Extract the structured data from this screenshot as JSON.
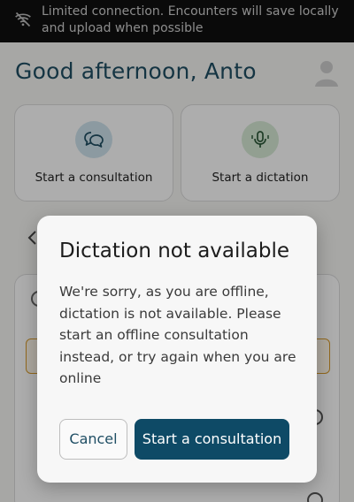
{
  "status_banner": {
    "icon": "wifi-off-icon",
    "text": "Limited connection. Encounters will save locally and upload when possible",
    "background": "#101010"
  },
  "home": {
    "greeting": "Good afternoon, Anto",
    "avatar_icon": "user-avatar-icon",
    "cards": [
      {
        "label": "Start a consultation",
        "icon": "chat-bubbles-icon"
      },
      {
        "label": "Start a dictation",
        "icon": "microphone-icon"
      }
    ]
  },
  "dialog": {
    "title": "Dictation not available",
    "message": "We're sorry, as you are offline, dictation is not available. Please start an offline consultation instead, or try again when you are online",
    "cancel_label": "Cancel",
    "confirm_label": "Start a consultation"
  },
  "colors": {
    "accent": "#0e4a66",
    "heading": "#1f4e64",
    "consult_icon_bg": "#cfe4ee",
    "dictation_icon_bg": "#d7ead6",
    "warning_border": "#d89a2a"
  }
}
